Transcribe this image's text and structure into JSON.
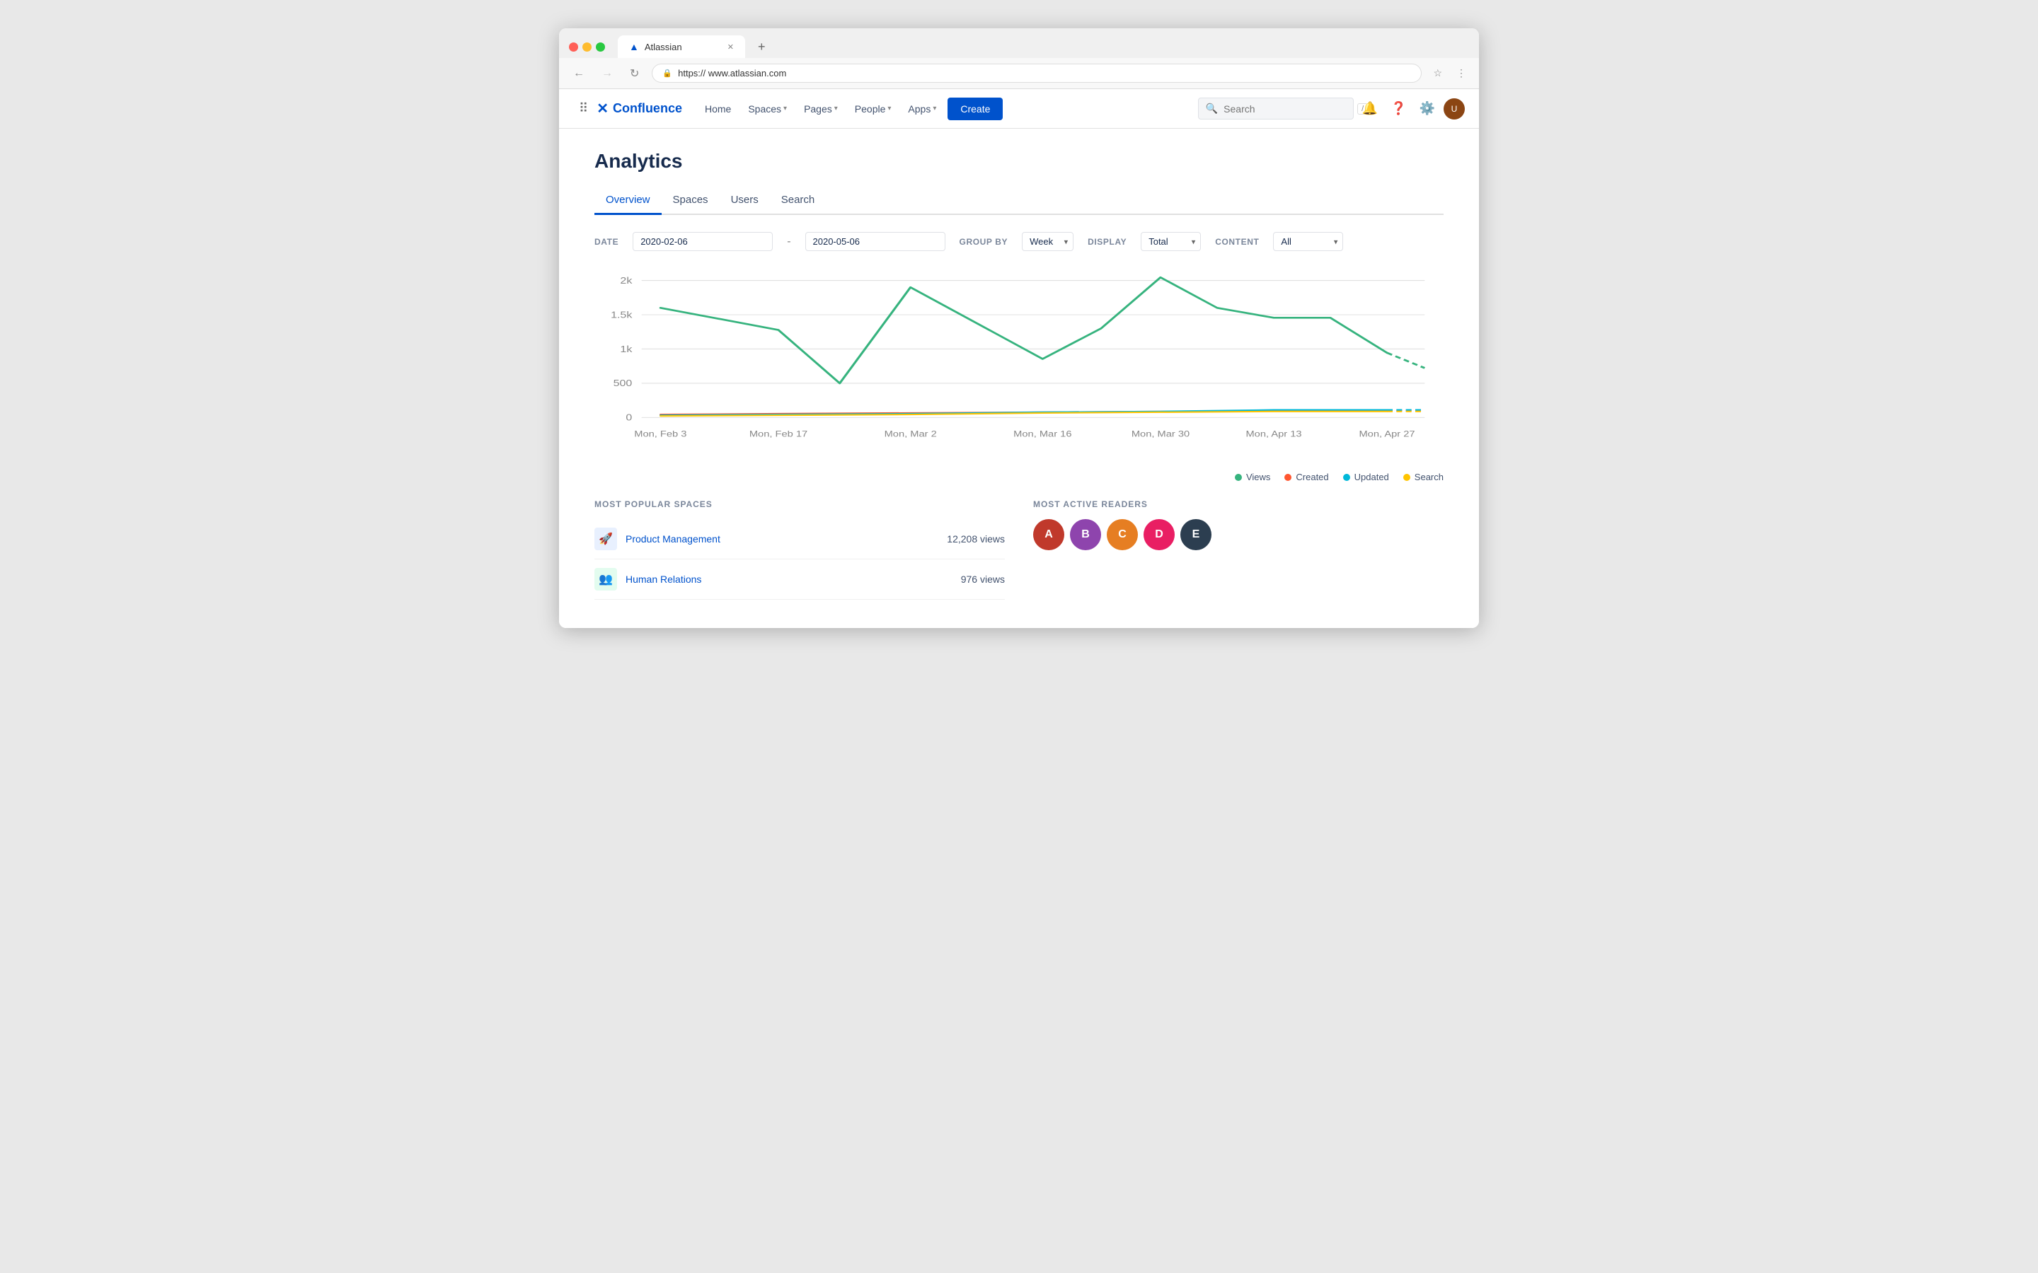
{
  "browser": {
    "url": "https:// www.atlassian.com",
    "tab_title": "Atlassian",
    "new_tab_label": "+"
  },
  "navbar": {
    "logo_text": "Confluence",
    "nav_items": [
      {
        "label": "Home",
        "has_dropdown": false
      },
      {
        "label": "Spaces",
        "has_dropdown": true
      },
      {
        "label": "Pages",
        "has_dropdown": true
      },
      {
        "label": "People",
        "has_dropdown": true
      },
      {
        "label": "Apps",
        "has_dropdown": true
      }
    ],
    "create_label": "Create",
    "search_placeholder": "Search",
    "search_shortcut": "/"
  },
  "page": {
    "title": "Analytics",
    "tabs": [
      {
        "label": "Overview",
        "active": true
      },
      {
        "label": "Spaces",
        "active": false
      },
      {
        "label": "Users",
        "active": false
      },
      {
        "label": "Search",
        "active": false
      }
    ]
  },
  "filters": {
    "date_label": "DATE",
    "date_from": "2020-02-06",
    "date_to": "2020-05-06",
    "group_by_label": "GROUP BY",
    "group_by_value": "Week",
    "display_label": "DISPLAY",
    "display_value": "Total",
    "content_label": "CONTENT",
    "content_value": "All"
  },
  "chart": {
    "y_labels": [
      "2k",
      "1.5k",
      "1k",
      "500",
      "0"
    ],
    "x_labels": [
      "Mon, Feb 3",
      "Mon, Feb 17",
      "Mon, Mar 2",
      "Mon, Mar 16",
      "Mon, Mar 30",
      "Mon, Apr 13",
      "Mon, Apr 27"
    ],
    "legend": [
      {
        "label": "Views",
        "color": "#36b37e"
      },
      {
        "label": "Created",
        "color": "#ff5630"
      },
      {
        "label": "Updated",
        "color": "#00b8d9"
      },
      {
        "label": "Search",
        "color": "#ffc400"
      }
    ]
  },
  "most_popular_spaces": {
    "title": "MOST POPULAR SPACES",
    "items": [
      {
        "name": "Product Management",
        "views": "12,208 views",
        "color": "#4C9AFF",
        "emoji": "🚀"
      },
      {
        "name": "Human Relations",
        "views": "976 views",
        "color": "#36b37e",
        "emoji": "👥"
      }
    ]
  },
  "most_active_readers": {
    "title": "MOST ACTIVE READERS",
    "colors": [
      "#c0392b",
      "#8e44ad",
      "#e67e22",
      "#e91e63",
      "#2c3e50"
    ]
  }
}
